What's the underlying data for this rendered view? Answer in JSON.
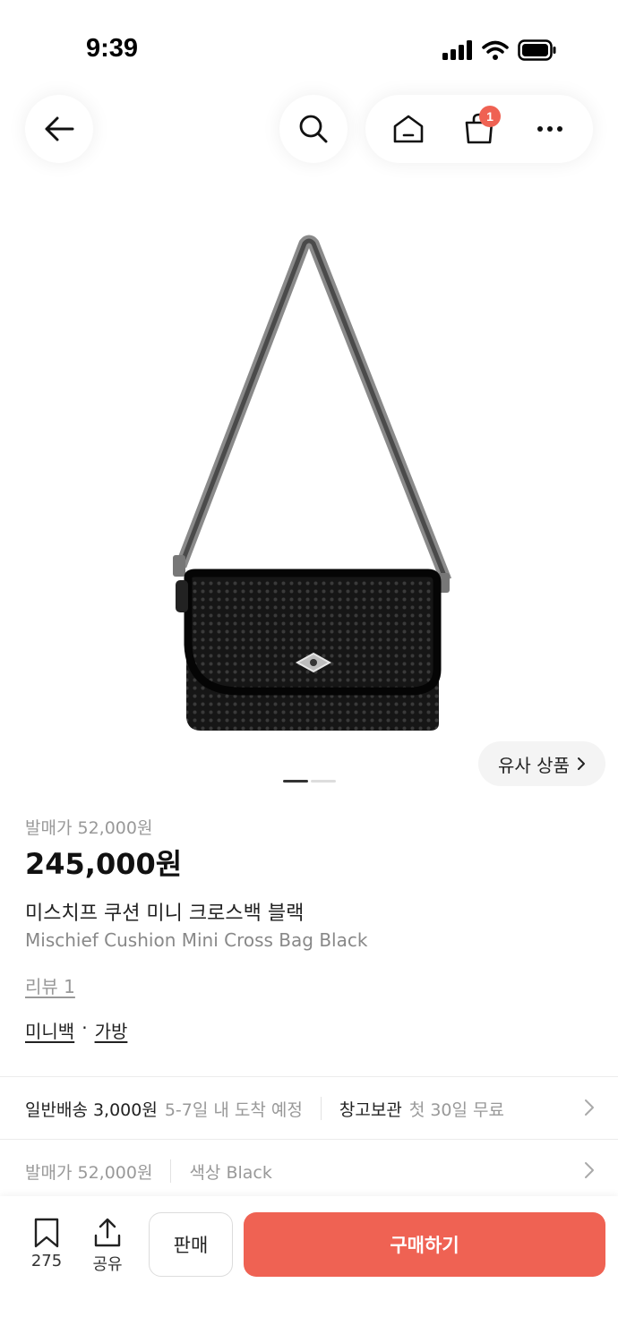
{
  "status_bar": {
    "time": "9:39"
  },
  "header": {
    "cart_badge": "1"
  },
  "product": {
    "release_price_label": "발매가 52,000원",
    "price": "245,000원",
    "name_ko": "미스치프 쿠션 미니 크로스백 블랙",
    "name_en": "Mischief Cushion Mini Cross Bag Black",
    "review_label": "리뷰 1",
    "categories": [
      "미니백",
      "가방"
    ],
    "category_separator": "·"
  },
  "image": {
    "similar_label": "유사 상품"
  },
  "shipping": {
    "type": "일반배송 3,000원",
    "eta": "5-7일 내 도착 예정",
    "storage": "창고보관",
    "storage_note": "첫 30일 무료"
  },
  "options": {
    "release_price": "발매가 52,000원",
    "color": "색상 Black"
  },
  "bottom_bar": {
    "bookmark_count": "275",
    "share_label": "공유",
    "sell_label": "판매",
    "buy_label": "구매하기"
  },
  "colors": {
    "accent": "#ef6253"
  }
}
